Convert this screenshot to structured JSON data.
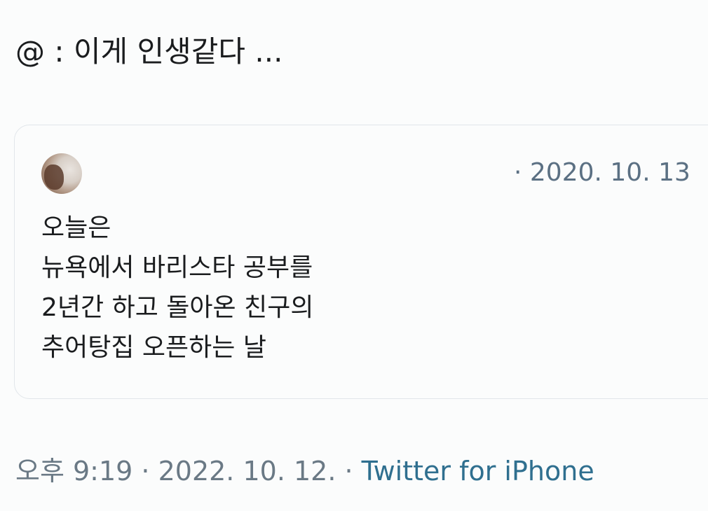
{
  "tweet": {
    "text": "@ : 이게 인생같다 ..."
  },
  "quoted_tweet": {
    "date": "· 2020. 10. 13",
    "lines": [
      "오늘은",
      "뉴욕에서 바리스타 공부를",
      "2년간 하고 돌아온 친구의",
      "추어탕집 오픈하는 날"
    ]
  },
  "meta": {
    "time": "오후 9:19",
    "separator1": " · ",
    "date": "2022. 10. 12.",
    "separator2": " · ",
    "source": "Twitter for iPhone"
  },
  "colors": {
    "text": "#1a1c1e",
    "secondary": "#5b7083",
    "link": "#2f6f8f",
    "border": "#e1e6ea"
  }
}
